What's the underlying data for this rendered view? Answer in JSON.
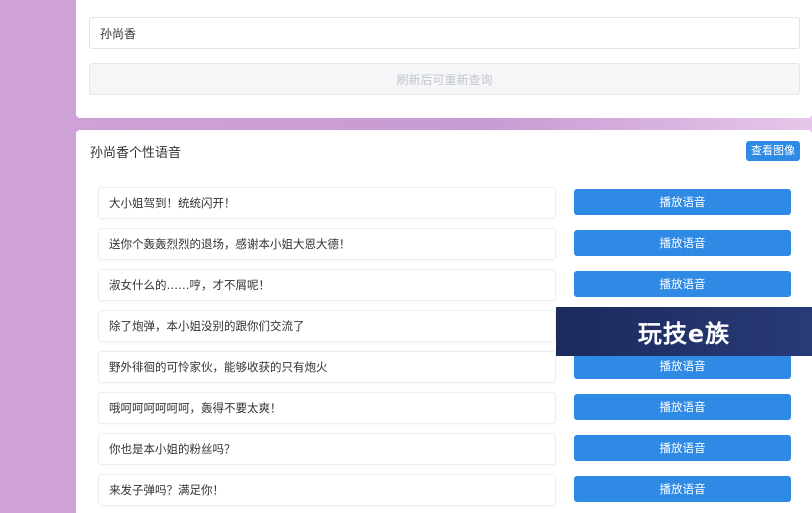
{
  "search": {
    "value": "孙尚香",
    "refresh_label": "刷新后可重新查询"
  },
  "voices_card": {
    "title": "孙尚香个性语音",
    "view_image_label": "查看图像",
    "play_label": "播放语音",
    "items": [
      "大小姐驾到！统统闪开！",
      "送你个轰轰烈烈的退场，感谢本小姐大恩大德！",
      "淑女什么的……哼，才不屑呢！",
      "除了炮弹，本小姐没别的跟你们交流了",
      "野外徘徊的可怜家伙，能够收获的只有炮火",
      "哦呵呵呵呵呵呵，轰得不要太爽！",
      "你也是本小姐的粉丝吗？",
      "来发子弹吗？满足你！"
    ]
  },
  "watermark": {
    "text": "玩技e族"
  },
  "colors": {
    "accent": "#2f8ae5",
    "background": "#c79bd3",
    "watermark_bg": "#1c2a5c"
  }
}
